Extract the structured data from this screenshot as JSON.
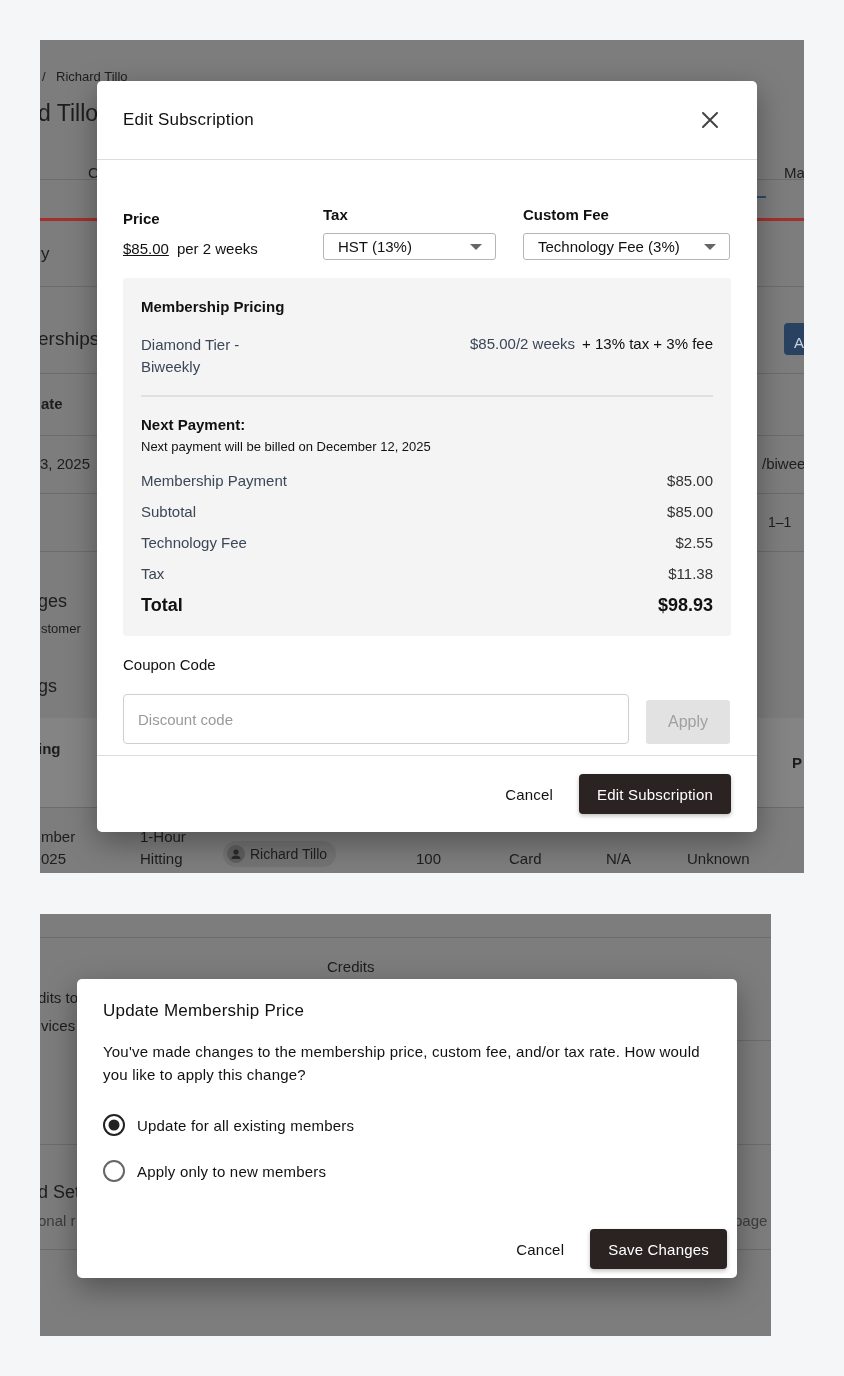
{
  "panels": [
    {
      "backdrop": {
        "breadcrumb_separator": "/",
        "breadcrumb_current": "Richard Tillo",
        "page_title": "d Tillo",
        "tab_1": "C",
        "tab_2": "Ma",
        "section_label": "y",
        "section_title": "erships",
        "add_button": "A",
        "column_header": "ate",
        "row_date": "3, 2025",
        "row_price": "/biwee",
        "pagination": "1–1",
        "section_2_title": "ges",
        "section_2_note": "stomer",
        "section_3_title": "gs",
        "table_header_1": "ing",
        "table_header_2": "P",
        "booking_row": {
          "date": [
            "mber",
            "025"
          ],
          "service": [
            "1-Hour",
            "Hitting"
          ],
          "customer": "Richard Tillo",
          "credits": "100",
          "payment": "Card",
          "column_6": "N/A",
          "status": "Unknown"
        }
      },
      "dialog": {
        "kind": "edit",
        "title": "Edit Subscription",
        "price": {
          "label": "Price",
          "amount": "$85.00",
          "period": "per 2 weeks"
        },
        "selects": [
          {
            "label": "Tax",
            "value": "HST (13%)"
          },
          {
            "label": "Custom Fee",
            "value": "Technology Fee (3%)"
          }
        ],
        "summary": {
          "title": "Membership Pricing",
          "plan": "Diamond Tier - Biweekly",
          "plan_price": "$85.00/2 weeks",
          "extras": "+ 13% tax + 3% fee",
          "next_title": "Next Payment:",
          "next_note": "Next payment will be billed on December 12, 2025",
          "lines": [
            {
              "label": "Membership Payment",
              "amount": "$85.00"
            },
            {
              "label": "Subtotal",
              "amount": "$85.00"
            },
            {
              "label": "Technology Fee",
              "amount": "$2.55"
            },
            {
              "label": "Tax",
              "amount": "$11.38"
            }
          ],
          "total": {
            "label": "Total",
            "amount": "$98.93"
          }
        },
        "coupon": {
          "label": "Coupon Code",
          "placeholder": "Discount code",
          "apply": "Apply",
          "apply_disabled": true
        },
        "buttons": [
          {
            "label": "Cancel",
            "kind": "text"
          },
          {
            "label": "Edit Subscription",
            "kind": "primary"
          }
        ]
      }
    },
    {
      "backdrop": {
        "column_header": "Credits",
        "left_line_1": "dits to",
        "left_line_2": "vices",
        "section_title": "d Set",
        "section_note": "onal r",
        "right_note": "page"
      },
      "dialog": {
        "kind": "confirm",
        "title": "Update Membership Price",
        "message": "You've made changes to the membership price, custom fee, and/or tax rate. How would you like to apply this change?",
        "options": [
          {
            "label": "Update for all existing members",
            "selected": true
          },
          {
            "label": "Apply only to new members",
            "selected": false
          }
        ],
        "buttons": [
          {
            "label": "Cancel",
            "kind": "text"
          },
          {
            "label": "Save Changes",
            "kind": "primary"
          }
        ]
      }
    }
  ]
}
